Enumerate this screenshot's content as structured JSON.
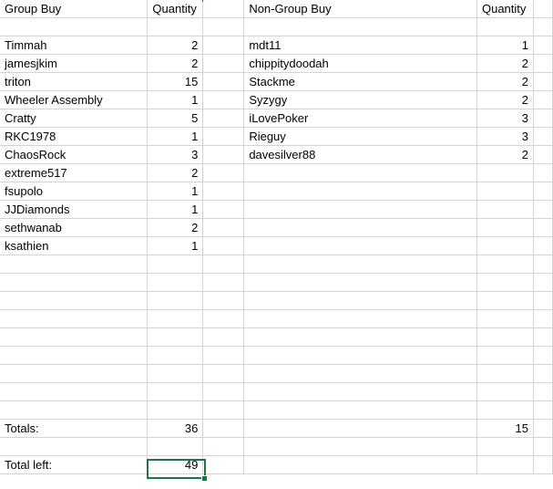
{
  "headers": {
    "group_buy": "Group Buy",
    "group_quantity": "Quantity",
    "non_group_buy": "Non-Group Buy",
    "non_group_quantity": "Quantity"
  },
  "group_buy": [
    {
      "name": "Timmah",
      "qty": "2"
    },
    {
      "name": "jamesjkim",
      "qty": "2"
    },
    {
      "name": "triton",
      "qty": "15"
    },
    {
      "name": "Wheeler Assembly",
      "qty": "1"
    },
    {
      "name": "Cratty",
      "qty": "5"
    },
    {
      "name": "RKC1978",
      "qty": "1"
    },
    {
      "name": "ChaosRock",
      "qty": "3"
    },
    {
      "name": "extreme517",
      "qty": "2"
    },
    {
      "name": "fsupolo",
      "qty": "1"
    },
    {
      "name": "JJDiamonds",
      "qty": "1"
    },
    {
      "name": "sethwanab",
      "qty": "2"
    },
    {
      "name": "ksathien",
      "qty": "1"
    }
  ],
  "non_group_buy": [
    {
      "name": "mdt11",
      "qty": "1"
    },
    {
      "name": "chippitydoodah",
      "qty": "2"
    },
    {
      "name": "Stackme",
      "qty": "2"
    },
    {
      "name": "Syzygy",
      "qty": "2"
    },
    {
      "name": "iLovePoker",
      "qty": "3"
    },
    {
      "name": "Rieguy",
      "qty": "3"
    },
    {
      "name": "davesilver88",
      "qty": "2"
    }
  ],
  "totals": {
    "label": "Totals:",
    "group_total": "36",
    "non_group_total": "15"
  },
  "total_left": {
    "label": "Total left:",
    "value": "49"
  },
  "colors": {
    "gridline": "#d4d4d4",
    "selection": "#217346"
  }
}
